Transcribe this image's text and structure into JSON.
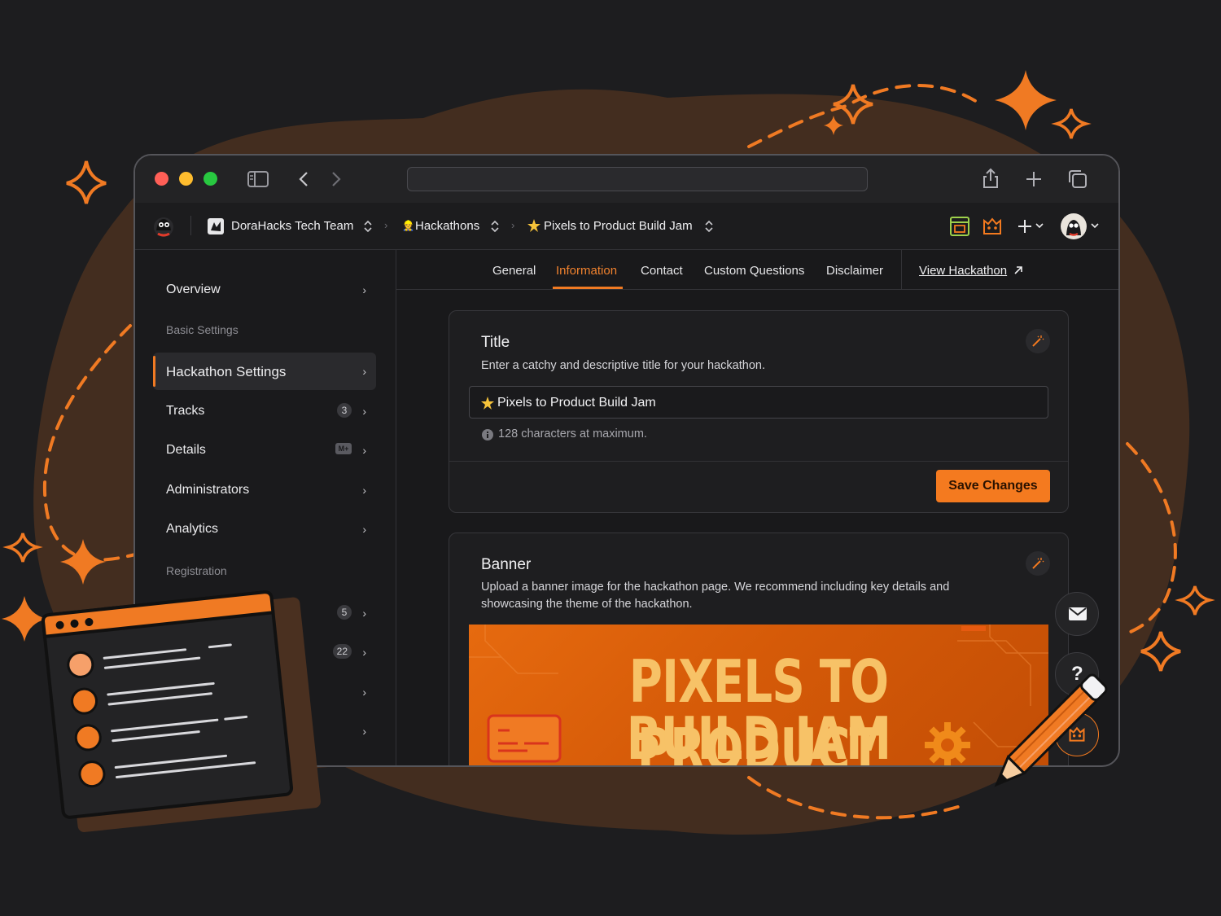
{
  "colors": {
    "accent": "#f47a1f",
    "background": "#1d1d1f",
    "panel": "#1e1e20",
    "blob": "#4a3020"
  },
  "header": {
    "team": "DoraHacks Tech Team",
    "section": "Hackathons",
    "hackathon": "Pixels to Product Build Jam"
  },
  "tabs": [
    {
      "label": "General"
    },
    {
      "label": "Information"
    },
    {
      "label": "Contact"
    },
    {
      "label": "Custom Questions"
    },
    {
      "label": "Disclaimer"
    }
  ],
  "active_tab": "Information",
  "view_link": "View Hackathon",
  "sidebar": {
    "overview": "Overview",
    "basic_settings_heading": "Basic Settings",
    "items": [
      {
        "label": "Hackathon Settings"
      },
      {
        "label": "Tracks",
        "badge": "3"
      },
      {
        "label": "Details",
        "badge": "M+"
      },
      {
        "label": "Administrators"
      },
      {
        "label": "Analytics"
      }
    ],
    "registration_heading": "Registration",
    "registration_badges": [
      "5",
      "22"
    ]
  },
  "title_card": {
    "title": "Title",
    "description": "Enter a catchy and descriptive title for your hackathon.",
    "value": "Pixels to Product Build Jam",
    "hint": "128 characters at maximum.",
    "save_label": "Save Changes"
  },
  "banner_card": {
    "title": "Banner",
    "description": "Upload a banner image for the hackathon page. We recommend including key details and showcasing the theme of the hackathon.",
    "banner_line1": "PIXELS TO PRODUCT",
    "banner_line2": "BUILD JAM"
  },
  "floating": {
    "help_label": "?"
  },
  "icons": [
    "sidebar-toggle-icon",
    "back-icon",
    "forward-icon",
    "share-icon",
    "new-tab-icon",
    "tabs-icon",
    "logo-icon",
    "team-icon",
    "chevron-updown-icon",
    "workspace-icon",
    "bot-icon",
    "plus-icon",
    "avatar-icon",
    "magic-wand-icon",
    "info-icon",
    "mail-icon",
    "help-icon",
    "star-icon"
  ]
}
